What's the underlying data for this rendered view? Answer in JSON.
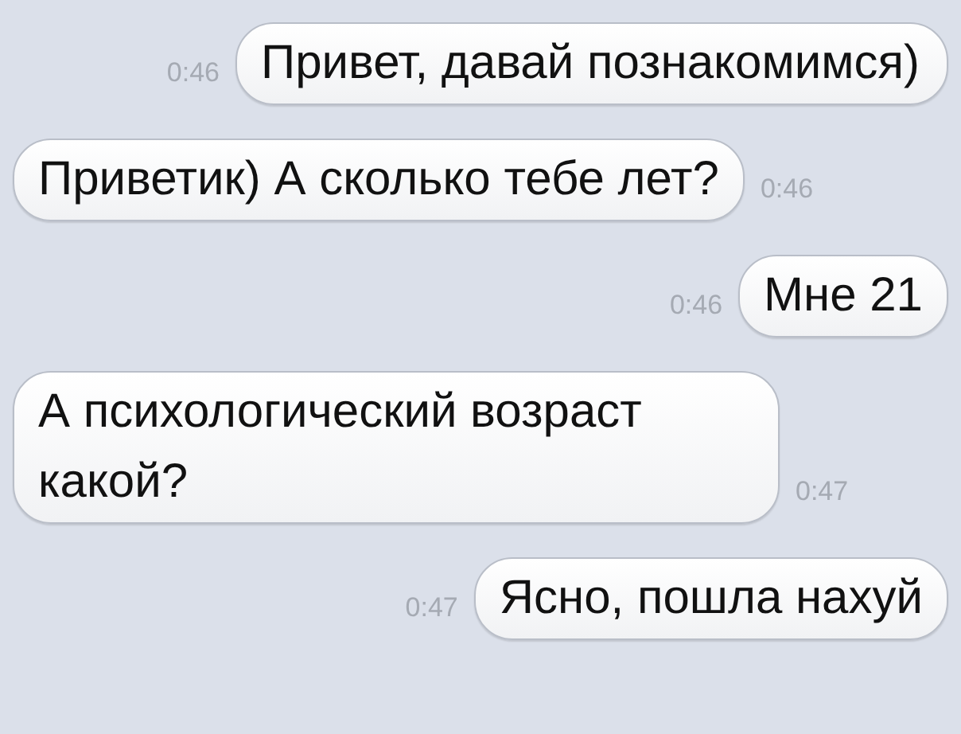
{
  "messages": [
    {
      "kind": "sent",
      "text": "Привет, давай познакомимся)",
      "time": "0:46"
    },
    {
      "kind": "received",
      "text": "Приветик) А сколько тебе лет?",
      "time": "0:46"
    },
    {
      "kind": "sent",
      "text": "Мне 21",
      "time": "0:46"
    },
    {
      "kind": "received",
      "text": "А психологический возраст какой?",
      "time": "0:47"
    },
    {
      "kind": "sent",
      "text": "Ясно, пошла нахуй",
      "time": "0:47"
    }
  ]
}
